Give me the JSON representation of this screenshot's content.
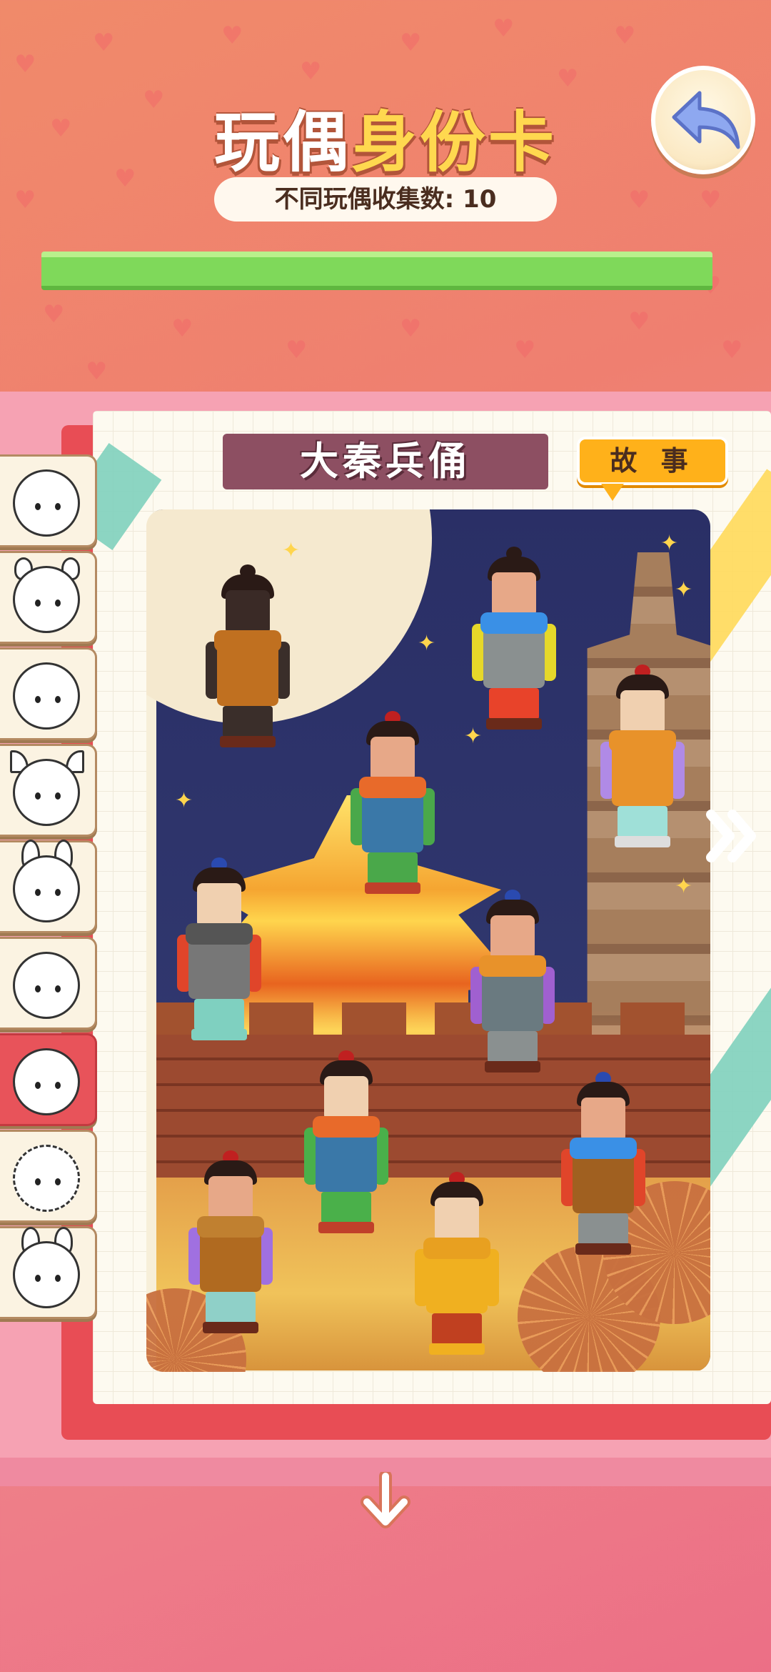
{
  "header": {
    "title_part1": "玩偶",
    "title_part2": "身份卡",
    "collection_count_text": "不同玩偶收集数: 10",
    "progress": 1.0,
    "progress_color": "#7fd95a"
  },
  "back_button": {
    "icon": "back-arrow-icon"
  },
  "card": {
    "name": "大秦兵俑",
    "story_button": "故 事"
  },
  "sidebar": {
    "items": [
      {
        "icon": "seal-doll-icon",
        "active": false
      },
      {
        "icon": "bear-doll-icon",
        "active": false
      },
      {
        "icon": "tomato-doll-icon",
        "active": false
      },
      {
        "icon": "fox-doll-icon",
        "active": false
      },
      {
        "icon": "rabbit-girl-doll-icon",
        "active": false
      },
      {
        "icon": "crown-doll-icon",
        "active": false
      },
      {
        "icon": "terracotta-warrior-doll-icon",
        "active": true
      },
      {
        "icon": "cloud-hair-doll-icon",
        "active": false
      },
      {
        "icon": "bunny-hood-doll-icon",
        "active": false
      }
    ]
  },
  "navigation": {
    "next_icon": "double-chevron-right-icon",
    "down_icon": "arrow-down-icon"
  },
  "colors": {
    "accent_orange": "#ffb11a",
    "banner": "#8d4f62",
    "active_tab": "#e8535a"
  }
}
